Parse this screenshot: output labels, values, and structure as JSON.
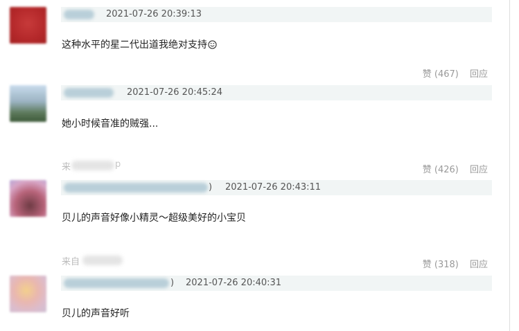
{
  "comments": [
    {
      "timestamp": "2021-07-26 20:39:13",
      "text": "这种水平的星二代出道我绝对支持",
      "emoji_icon": "smiling-face-icon",
      "actions": {
        "like_label": "赞 (467)",
        "reply_label": "回应"
      }
    },
    {
      "timestamp": "2021-07-26 20:45:24",
      "text": "她小时候音准的贼强...",
      "source": {
        "label": "来",
        "tail": "p"
      },
      "actions": {
        "like_label": "赞 (426)",
        "reply_label": "回应"
      }
    },
    {
      "paren": ")",
      "timestamp": "2021-07-26 20:43:11",
      "text": "贝儿的声音好像小精灵～超级美好的小宝贝",
      "source": {
        "label": "来自"
      },
      "actions": {
        "like_label": "赞 (318)",
        "reply_label": "回应"
      }
    },
    {
      "paren": ")",
      "timestamp": "2021-07-26 20:40:31",
      "text": "贝儿的声音好听"
    }
  ],
  "colors": {
    "header_bar": "#f1f5f5",
    "timestamp": "#555555",
    "muted": "#999999",
    "text": "#222222"
  }
}
